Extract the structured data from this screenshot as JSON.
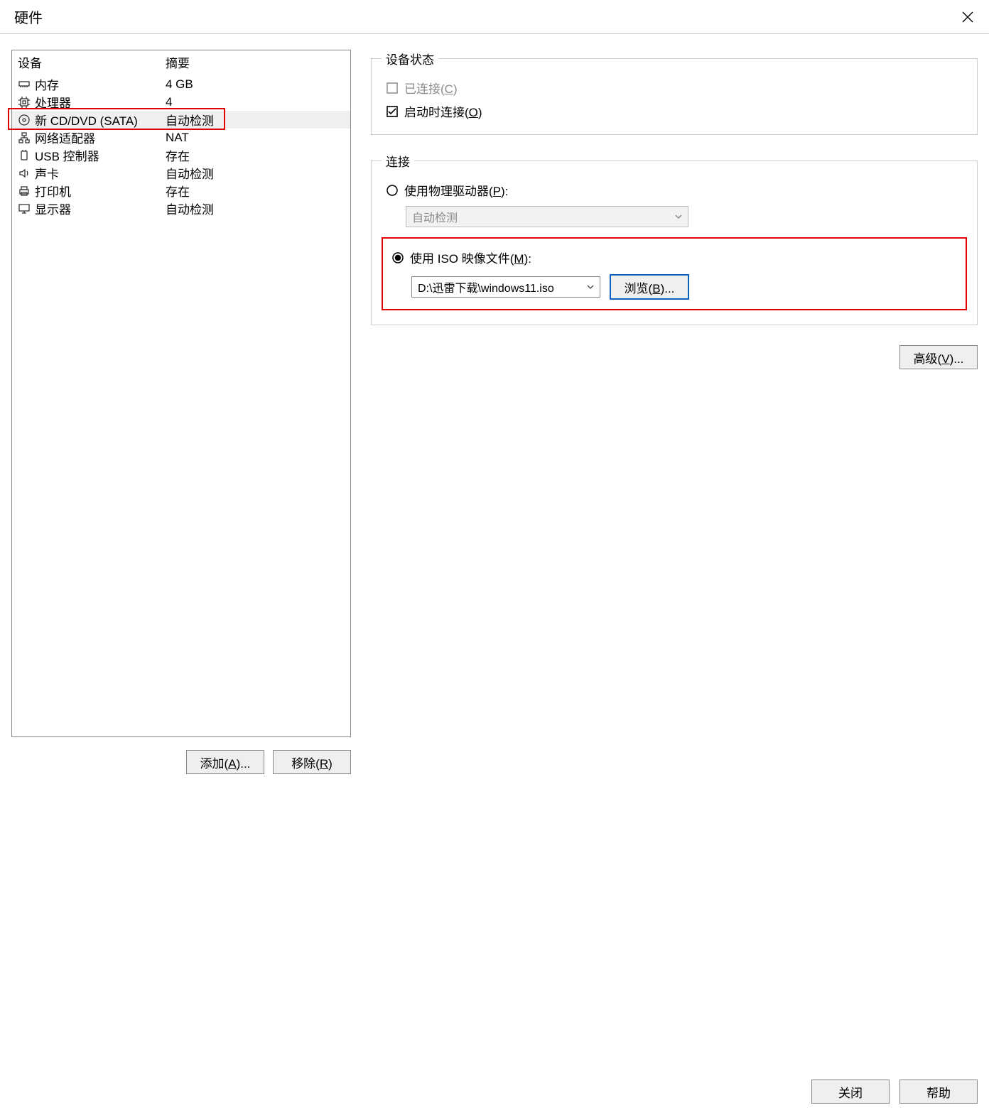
{
  "window": {
    "title": "硬件"
  },
  "device_list": {
    "headers": {
      "device": "设备",
      "summary": "摘要"
    },
    "rows": [
      {
        "icon": "memory",
        "name": "内存",
        "summary": "4 GB"
      },
      {
        "icon": "cpu",
        "name": "处理器",
        "summary": "4"
      },
      {
        "icon": "disc",
        "name": "新 CD/DVD (SATA)",
        "summary": "自动检测",
        "selected": true,
        "highlight": true
      },
      {
        "icon": "network",
        "name": "网络适配器",
        "summary": "NAT"
      },
      {
        "icon": "usb",
        "name": "USB 控制器",
        "summary": "存在"
      },
      {
        "icon": "sound",
        "name": "声卡",
        "summary": "自动检测"
      },
      {
        "icon": "printer",
        "name": "打印机",
        "summary": "存在"
      },
      {
        "icon": "display",
        "name": "显示器",
        "summary": "自动检测"
      }
    ]
  },
  "buttons": {
    "add": "添加(A)...",
    "remove": "移除(R)",
    "browse": "浏览(B)...",
    "advanced": "高级(V)...",
    "close": "关闭",
    "help": "帮助"
  },
  "status_group": {
    "legend": "设备状态",
    "connected": {
      "label": "已连接(C)",
      "checked": false,
      "disabled": true
    },
    "connect_at_start": {
      "label": "启动时连接(O)",
      "checked": true,
      "disabled": false
    }
  },
  "connection_group": {
    "legend": "连接",
    "physical": {
      "label": "使用物理驱动器(P):",
      "selected": false,
      "dropdown_value": "自动检测",
      "dropdown_disabled": true
    },
    "iso": {
      "label": "使用 ISO 映像文件(M):",
      "selected": true,
      "path": "D:\\迅雷下载\\windows11.iso",
      "highlight": true
    }
  }
}
